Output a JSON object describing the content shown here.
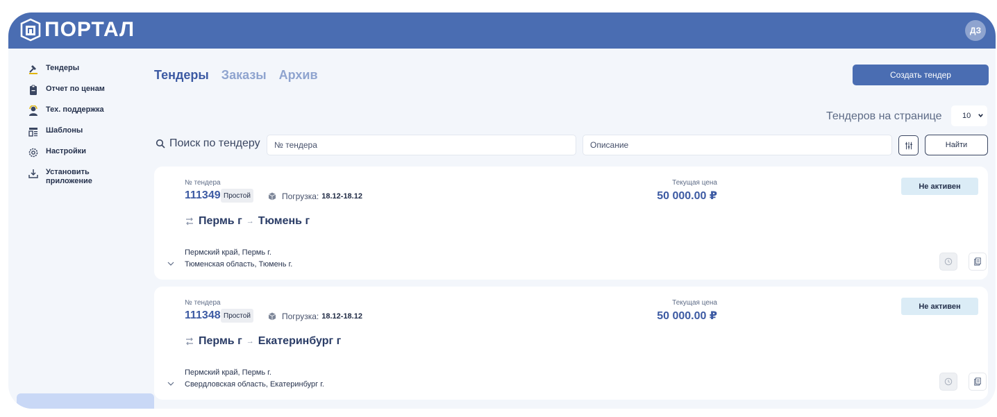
{
  "header": {
    "logo_text": "ПОРТАЛ",
    "avatar_initials": "ДЗ"
  },
  "sidebar": {
    "items": [
      {
        "label": "Тендеры",
        "icon": "gavel-icon"
      },
      {
        "label": "Отчет по ценам",
        "icon": "clipboard-icon"
      },
      {
        "label": "Тех. поддержка",
        "icon": "support-agent-icon"
      },
      {
        "label": "Шаблоны",
        "icon": "template-icon"
      },
      {
        "label": "Настройки",
        "icon": "gear-icon"
      },
      {
        "label": "Установить приложение",
        "icon": "download-icon"
      }
    ]
  },
  "tabs": [
    {
      "label": "Тендеры",
      "active": true
    },
    {
      "label": "Заказы",
      "active": false
    },
    {
      "label": "Архив",
      "active": false
    }
  ],
  "toolbar": {
    "create_label": "Создать тендер",
    "per_page_label": "Тендеров на странице",
    "per_page_value": "10"
  },
  "search": {
    "label": "Поиск по тендеру",
    "number_placeholder": "№ тендера",
    "description_placeholder": "Описание",
    "find_label": "Найти"
  },
  "tenders": [
    {
      "number_label": "№ тендера",
      "number": "111349",
      "type": "Простой",
      "load_label": "Погрузка:",
      "load_dates": "18.12-18.12",
      "price_label": "Текущая цена",
      "price": "50 000.00 ₽",
      "status": "Не активен",
      "from_city": "Пермь г",
      "to_city": "Тюмень г",
      "from_address": "Пермский край, Пермь г.",
      "to_address": "Тюменская область, Тюмень г."
    },
    {
      "number_label": "№ тендера",
      "number": "111348",
      "type": "Простой",
      "load_label": "Погрузка:",
      "load_dates": "18.12-18.12",
      "price_label": "Текущая цена",
      "price": "50 000.00 ₽",
      "status": "Не активен",
      "from_city": "Пермь г",
      "to_city": "Екатеринбург г",
      "from_address": "Пермский край, Пермь г.",
      "to_address": "Свердловская область, Екатеринбург г."
    }
  ],
  "colors": {
    "brand": "#4a6db2",
    "accent_text": "#3c5aa3",
    "status_bg": "#dbecf6",
    "page_bg": "#f3f6fb"
  }
}
